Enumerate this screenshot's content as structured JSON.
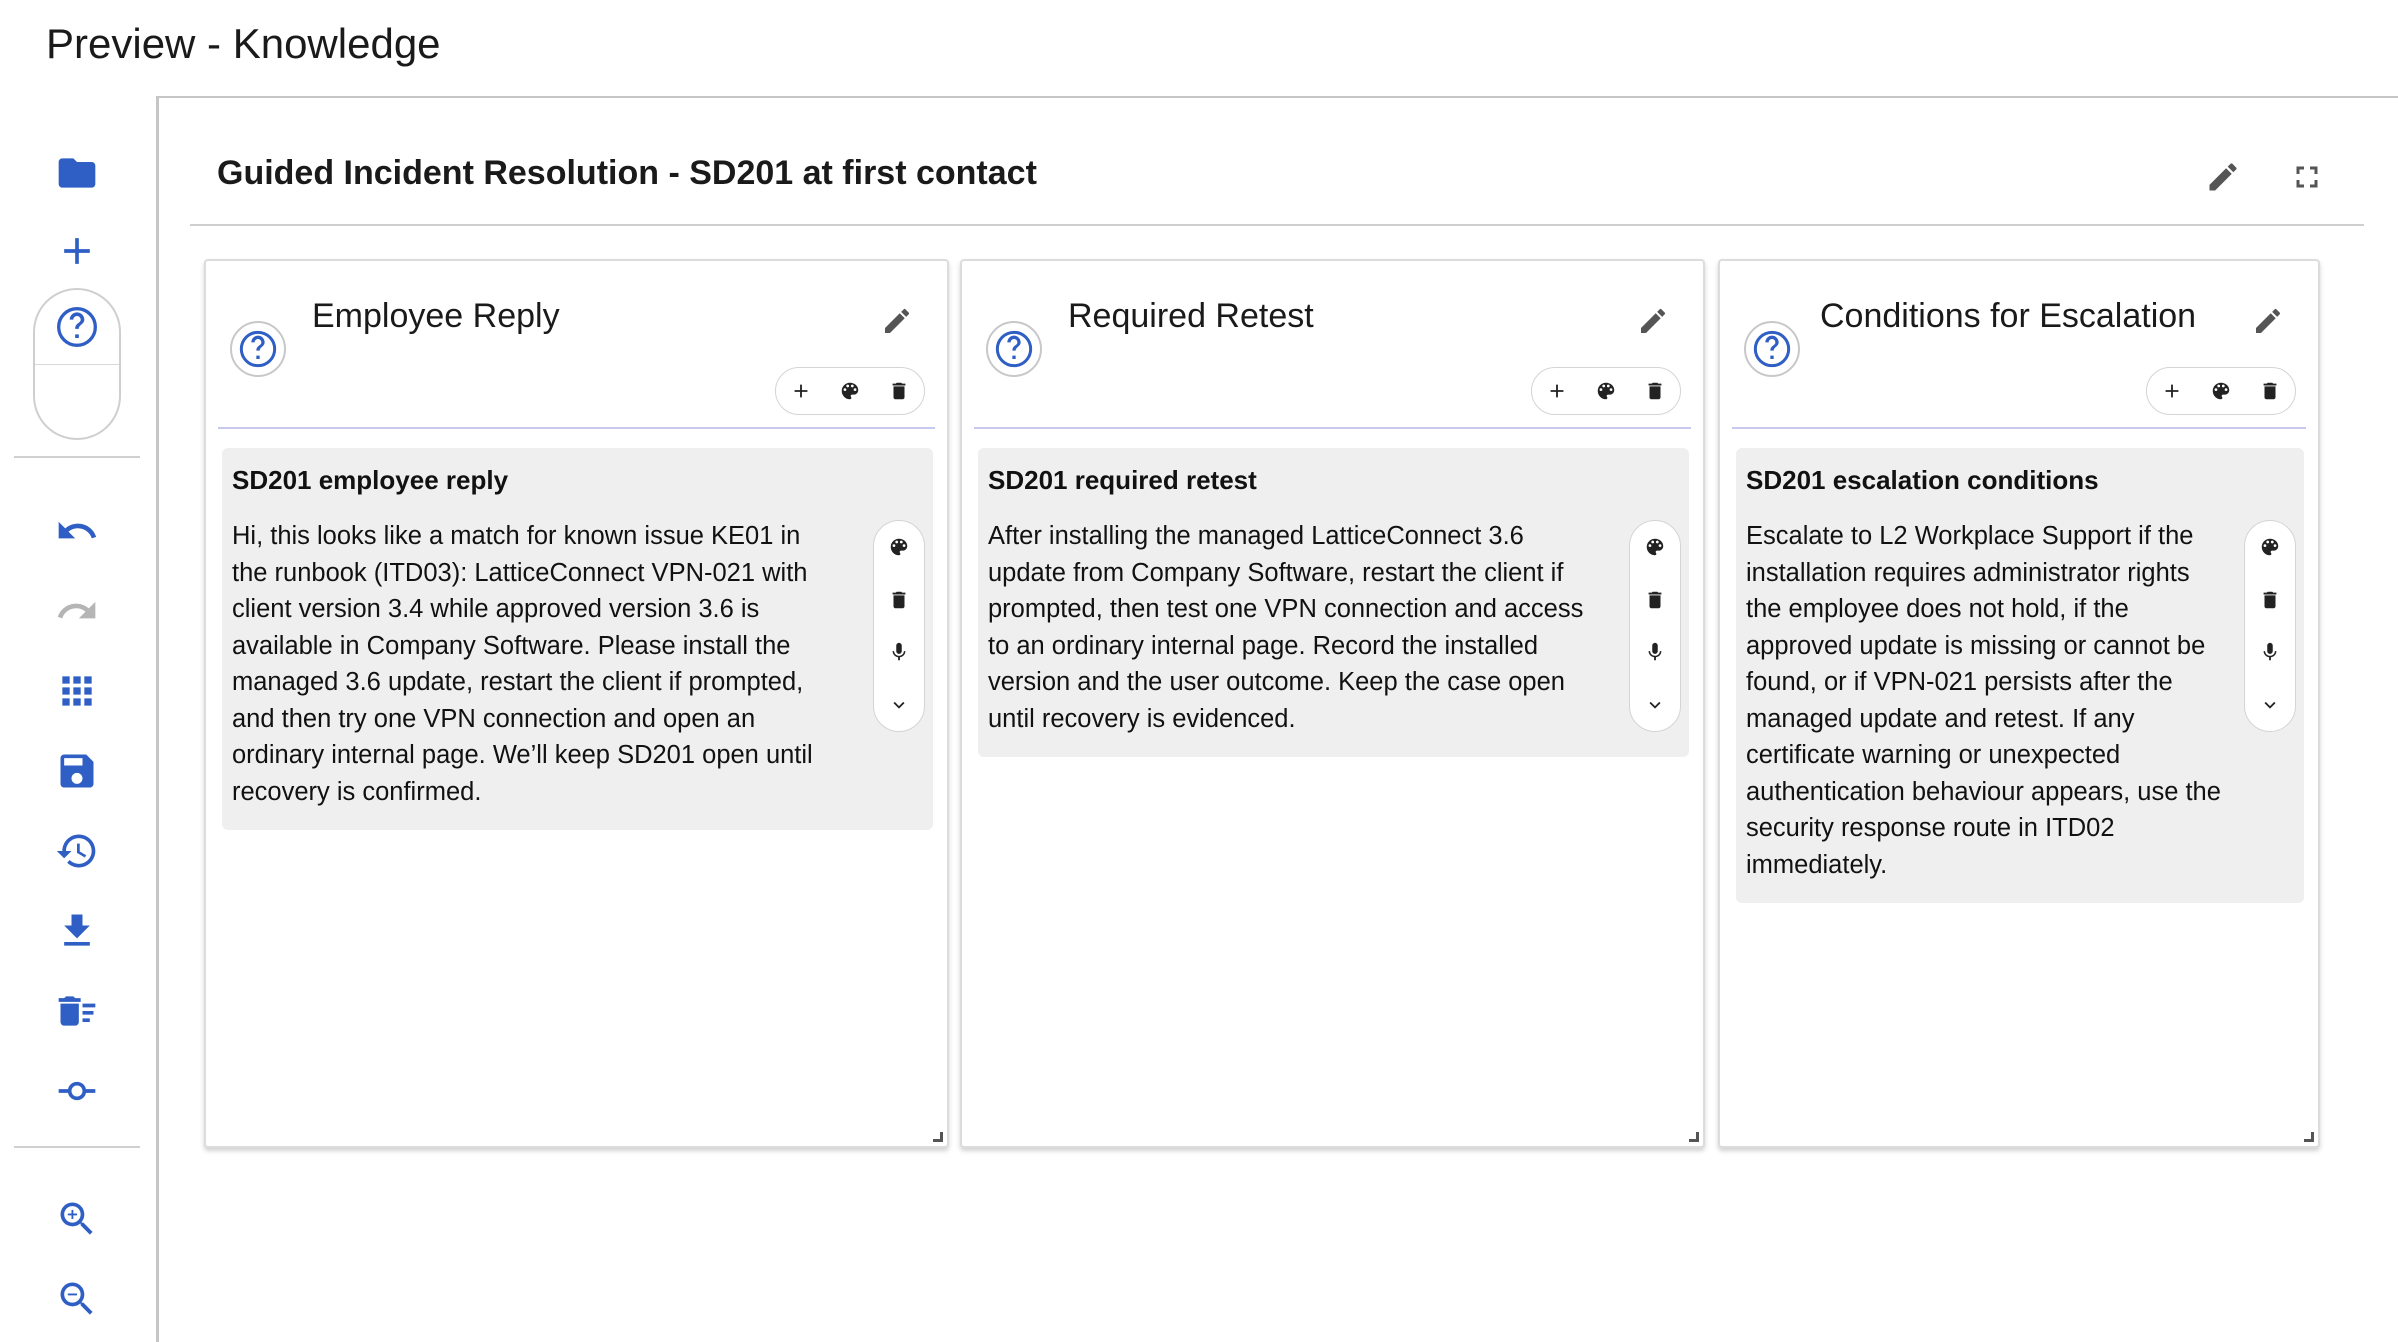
{
  "window": {
    "title": "Preview - Knowledge"
  },
  "toolbar": {
    "items": [
      {
        "name": "folder-icon"
      },
      {
        "name": "add-icon"
      },
      {
        "name": "help-icon"
      },
      {
        "name": "undo-icon"
      },
      {
        "name": "redo-icon"
      },
      {
        "name": "grid-icon"
      },
      {
        "name": "save-icon"
      },
      {
        "name": "history-icon"
      },
      {
        "name": "download-icon"
      },
      {
        "name": "clear-all-icon"
      },
      {
        "name": "commit-icon"
      },
      {
        "name": "zoom-in-icon"
      },
      {
        "name": "zoom-out-icon"
      }
    ],
    "accent_color": "#2f5fc4",
    "disabled_color": "#b5b5b5"
  },
  "board": {
    "title": "Guided Incident Resolution - SD201 at first contact"
  },
  "cards": [
    {
      "title": "Employee Reply",
      "note_title": "SD201 employee reply",
      "note_body": "Hi, this looks like a match for known issue KE01 in the runbook (ITD03): LatticeConnect VPN-021 with client version 3.4 while approved version 3.6 is available in Company Software. Please install the managed 3.6 update, restart the client if prompted, and then try one VPN connection and open an ordinary internal page. We’ll keep SD201 open until recovery is confirmed."
    },
    {
      "title": "Required Retest",
      "note_title": "SD201 required retest",
      "note_body": "After installing the managed LatticeConnect 3.6 update from Company Software, restart the client if prompted, then test one VPN connection and access to an ordinary internal page. Record the installed version and the user outcome. Keep the case open until recovery is evidenced."
    },
    {
      "title": "Conditions for Escalation",
      "note_title": "SD201 escalation conditions",
      "note_body": "Escalate to L2 Workplace Support if the installation requires administrator rights the employee does not hold, if the approved update is missing or cannot be found, or if VPN-021 persists after the managed update and retest. If any certificate warning or unexpected authentication behaviour appears, use the security response route in ITD02 immediately."
    }
  ]
}
